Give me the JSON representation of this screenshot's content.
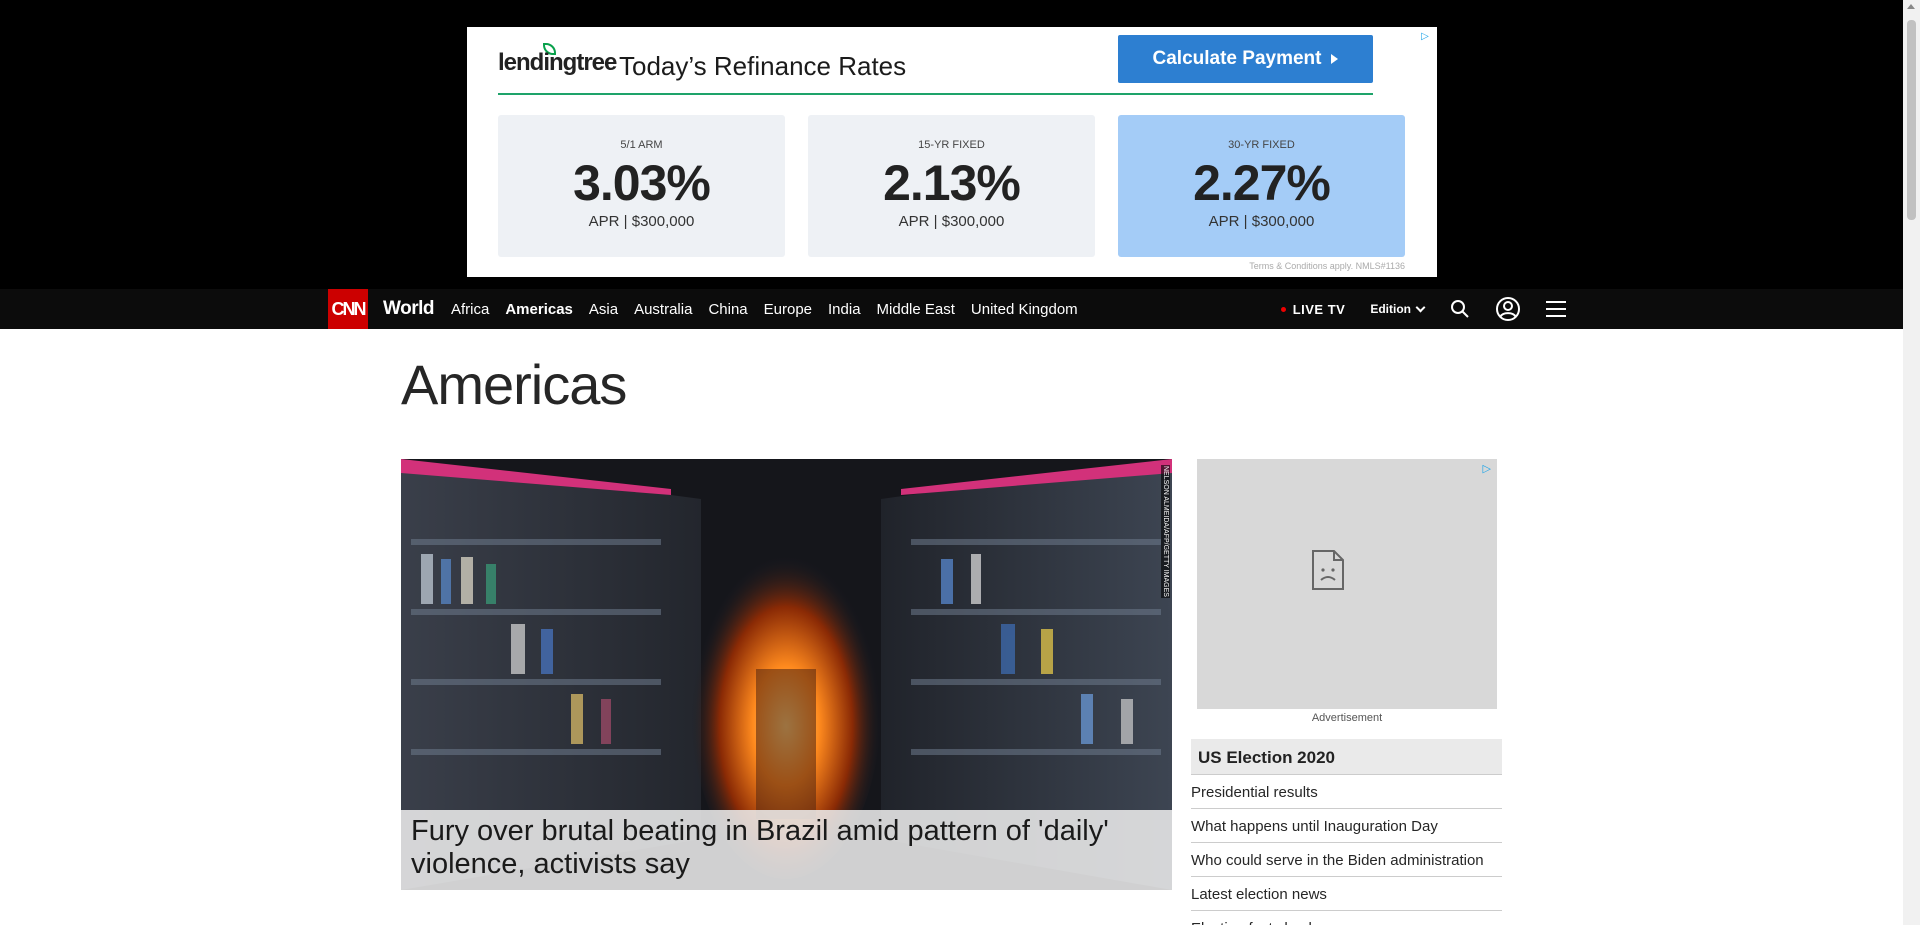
{
  "ad": {
    "brand": "lendingtree",
    "title": "Today’s Refinance Rates",
    "button_label": "Calculate Payment",
    "rates": [
      {
        "label": "5/1 ARM",
        "value": "3.03%",
        "sub": "APR | $300,000"
      },
      {
        "label": "15-YR FIXED",
        "value": "2.13%",
        "sub": "APR | $300,000"
      },
      {
        "label": "30-YR FIXED",
        "value": "2.27%",
        "sub": "APR  |  $300,000"
      }
    ],
    "terms": "Terms & Conditions apply. NMLS#1136"
  },
  "nav": {
    "logo": "CNN",
    "section": "World",
    "links": [
      "Africa",
      "Americas",
      "Asia",
      "Australia",
      "China",
      "Europe",
      "India",
      "Middle East",
      "United Kingdom"
    ],
    "active_link": "Americas",
    "live_tv": "LIVE TV",
    "edition": "Edition"
  },
  "page": {
    "title": "Americas"
  },
  "hero": {
    "headline": "Fury over brutal beating in Brazil amid pattern of 'daily' violence, activists say",
    "credit": "NELSON ALMEIDA/AFP/GETTY IMAGES"
  },
  "sidebar": {
    "ad_caption": "Advertisement",
    "election": {
      "heading": "US Election 2020",
      "items": [
        "Presidential results",
        "What happens until Inauguration Day",
        "Who could serve in the Biden administration",
        "Latest election news",
        "Election fact check"
      ]
    }
  },
  "colors": {
    "cnn_red": "#cc0000",
    "nav_bg": "#0c0c0c",
    "ad_button": "#2d7fd1",
    "highlight_card": "#a4ccf7",
    "lendingtree_green": "#1ea36a"
  }
}
